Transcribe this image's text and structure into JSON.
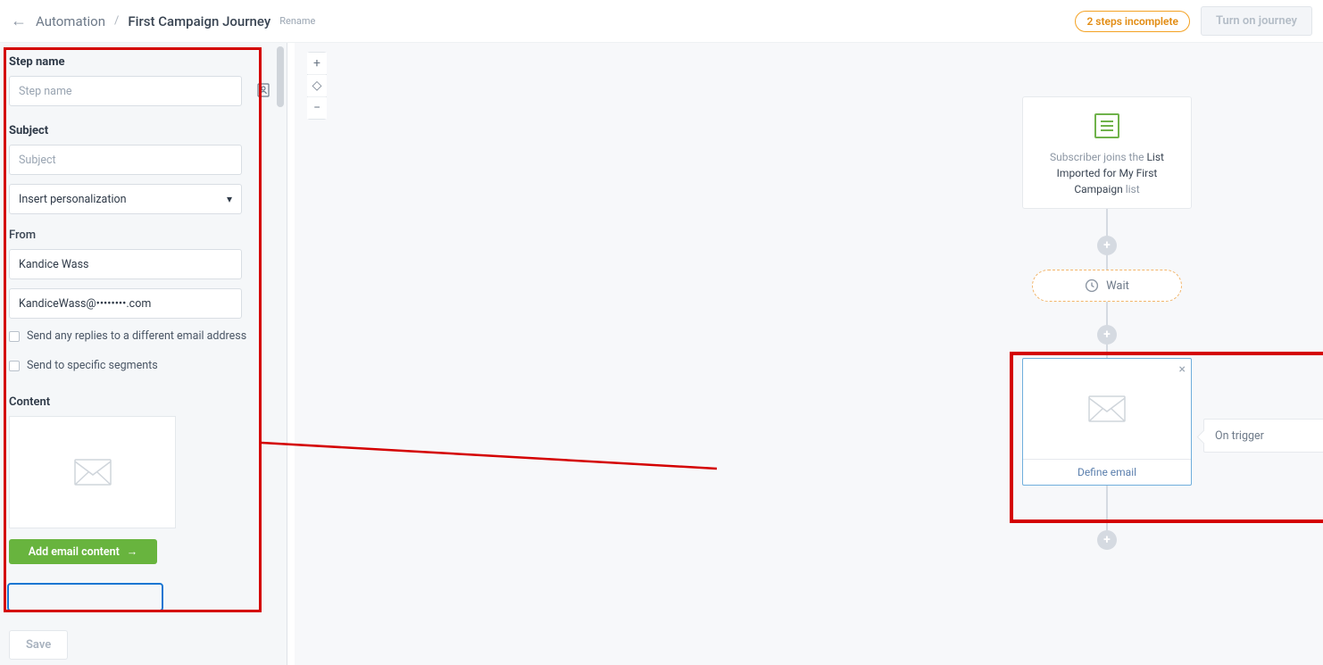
{
  "header": {
    "back_glyph": "←",
    "crumb_root": "Automation",
    "slash": "/",
    "title": "First Campaign Journey",
    "rename": "Rename",
    "status_pill": "2 steps incomplete",
    "turn_on": "Turn on journey"
  },
  "sidebar": {
    "step_name_label": "Step name",
    "step_name_placeholder": "Step name",
    "subject_label": "Subject",
    "subject_placeholder": "Subject",
    "personalization_select": "Insert personalization",
    "from_label": "From",
    "from_name": "Kandice Wass",
    "from_email": "KandiceWass@••••••••.com",
    "chk_replies": "Send any replies to a different email address",
    "chk_segments": "Send to specific segments",
    "content_label": "Content",
    "add_button": "Add email content",
    "add_arrow": "→",
    "save": "Save"
  },
  "zoom": {
    "plus": "+",
    "center": "◇",
    "minus": "−"
  },
  "canvas": {
    "trigger_prefix": "Subscriber joins the ",
    "trigger_strong1": "List Imported for My First Campaign",
    "trigger_suffix": " list",
    "wait": "Wait",
    "email_close": "×",
    "define_email": "Define email",
    "on_trigger": "On trigger",
    "plus": "+"
  }
}
